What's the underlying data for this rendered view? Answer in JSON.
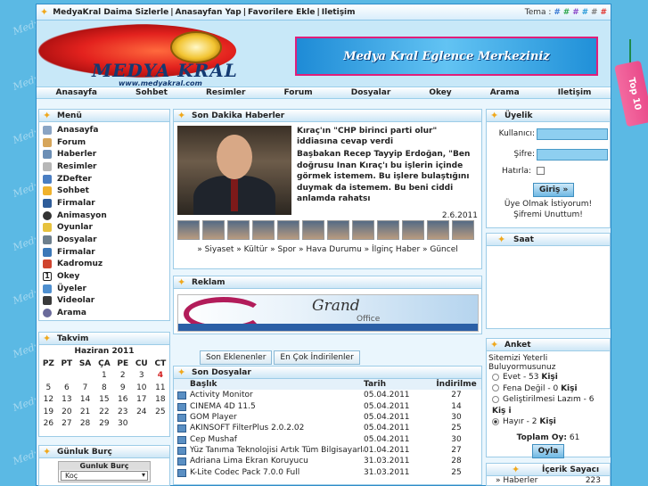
{
  "watermark": "Medy",
  "topbar": {
    "links": [
      "MedyaKral Daima Sizlerle",
      "Anasayfan Yap",
      "Favorilere Ekle",
      "Iletişim"
    ],
    "separator": "|",
    "theme_label": "Tema :",
    "theme_swatches": [
      {
        "symbol": "#",
        "color": "#3a7bd5"
      },
      {
        "symbol": "#",
        "color": "#2fa84f"
      },
      {
        "symbol": "#",
        "color": "#8a49c9"
      },
      {
        "symbol": "#",
        "color": "#2a9ad9"
      },
      {
        "symbol": "#",
        "color": "#7a7a7a"
      },
      {
        "symbol": "#",
        "color": "#e0332f"
      }
    ]
  },
  "header": {
    "logo_text": "MEDYA KRAL",
    "logo_sub": "www.medyakral.com",
    "banner_text": "Medya Kral Eglence Merkeziniz"
  },
  "nav": [
    "Anasayfa",
    "Sohbet",
    "Resimler",
    "Forum",
    "Dosyalar",
    "Okey",
    "Arama",
    "Iletişim"
  ],
  "menu": {
    "title": "Menü",
    "items": [
      {
        "label": "Anasayfa",
        "icon": "home-icon",
        "color": "#8aa4c4"
      },
      {
        "label": "Forum",
        "icon": "forum-icon",
        "color": "#d6a55a"
      },
      {
        "label": "Haberler",
        "icon": "news-icon",
        "color": "#6c8fb6"
      },
      {
        "label": "Resimler",
        "icon": "image-icon",
        "color": "#b7b7b7"
      },
      {
        "label": "ZDefter",
        "icon": "notebook-icon",
        "color": "#4a7ec2"
      },
      {
        "label": "Sohbet",
        "icon": "chat-icon",
        "color": "#f0b22c"
      },
      {
        "label": "Firmalar",
        "icon": "company-icon",
        "color": "#2e5d9a"
      },
      {
        "label": "Animasyon",
        "icon": "animation-icon",
        "color": "#333333"
      },
      {
        "label": "Oyunlar",
        "icon": "game-icon",
        "color": "#e7c23d"
      },
      {
        "label": "Dosyalar",
        "icon": "folder-icon",
        "color": "#6d7f8d"
      },
      {
        "label": "Firmalar",
        "icon": "company-icon",
        "color": "#3c78b8"
      },
      {
        "label": "Kadromuz",
        "icon": "team-icon",
        "color": "#d0452f"
      },
      {
        "label": "Okey",
        "icon": "okey-icon",
        "color": "#222222"
      },
      {
        "label": "Üyeler",
        "icon": "members-icon",
        "color": "#4f8fcf"
      },
      {
        "label": "Videolar",
        "icon": "video-icon",
        "color": "#3a3a3a"
      },
      {
        "label": "Arama",
        "icon": "search-icon",
        "color": "#6a6a9a"
      }
    ]
  },
  "calendar": {
    "title": "Takvim",
    "month": "Haziran 2011",
    "weekdays": [
      "PZ",
      "PT",
      "SA",
      "ÇA",
      "PE",
      "CU",
      "CT"
    ],
    "weeks": [
      [
        "",
        "",
        "",
        "1",
        "2",
        "3",
        "4"
      ],
      [
        "5",
        "6",
        "7",
        "8",
        "9",
        "10",
        "11"
      ],
      [
        "12",
        "13",
        "14",
        "15",
        "16",
        "17",
        "18"
      ],
      [
        "19",
        "20",
        "21",
        "22",
        "23",
        "24",
        "25"
      ],
      [
        "26",
        "27",
        "28",
        "29",
        "30",
        "",
        ""
      ]
    ],
    "highlight_day": "4",
    "highlight_color": "#d22020"
  },
  "horoscope": {
    "title": "Günluk Burç",
    "inner_title": "Gunluk Burç",
    "selected": "Koç"
  },
  "news": {
    "title": "Son Dakika Haberler",
    "headline": "Kıraç'ın \"CHP birinci parti olur\" iddiasına cevap verdi",
    "body": "Başbakan Recep Tayyip Erdoğan, \"Ben doğrusu Inan Kıraç'ı bu işlerin içinde görmek istemem. Bu işlere bulaştığını duymak da istemem. Bu beni ciddi anlamda rahatsı",
    "date": "2.6.2011",
    "categories": "» Siyaset » Kültür » Spor » Hava Durumu » İlginç Haber » Güncel"
  },
  "ad": {
    "title": "Reklam",
    "brand": "Grand",
    "brand_sub": "Office"
  },
  "downloads": {
    "tabs": [
      "Son Eklenenler",
      "En Çok İndirilenler"
    ],
    "title": "Son Dosyalar",
    "columns": [
      "Başlık",
      "Tarih",
      "İndirilme"
    ],
    "rows": [
      [
        "Activity Monitor",
        "05.04.2011",
        "27"
      ],
      [
        "CINEMA 4D 11.5",
        "05.04.2011",
        "14"
      ],
      [
        "GOM Player",
        "05.04.2011",
        "30"
      ],
      [
        "AKINSOFT FilterPlus 2.0.2.02",
        "05.04.2011",
        "25"
      ],
      [
        "Cep Mushaf",
        "05.04.2011",
        "30"
      ],
      [
        "Yüz Tanıma Teknolojisi Artık Tüm Bilgisayarlarda",
        "01.04.2011",
        "27"
      ],
      [
        "Adriana Lima Ekran Koruyucu",
        "31.03.2011",
        "28"
      ],
      [
        "K-Lite Codec Pack 7.0.0 Full",
        "31.03.2011",
        "25"
      ]
    ]
  },
  "login": {
    "title": "Üyelik",
    "user_label": "Kullanıcı:",
    "pass_label": "Şifre:",
    "remember_label": "Hatırla:",
    "submit": "Giriş »",
    "register": "Üye Olmak İstiyorum!",
    "forgot": "Şifremi Unuttum!"
  },
  "clock": {
    "title": "Saat"
  },
  "poll": {
    "title": "Anket",
    "question": "Sitemizi Yeterli Buluyormusunuz",
    "options": [
      {
        "text": "Evet - 53",
        "unit": "Kişi"
      },
      {
        "text": "Fena Değil - 0",
        "unit": "Kişi"
      },
      {
        "text": "Geliştirilmesi Lazım - 6",
        "unit": "Kiş i"
      },
      {
        "text": "Hayır - 2",
        "unit": "Kişi"
      }
    ],
    "selected_index": 3,
    "total_label": "Toplam Oy:",
    "total": "61",
    "vote_button": "Oyla"
  },
  "counter": {
    "title": "İçerik Sayacı",
    "rows": [
      {
        "label": "» Haberler",
        "value": "223"
      }
    ]
  },
  "side_tag": "Top 10"
}
